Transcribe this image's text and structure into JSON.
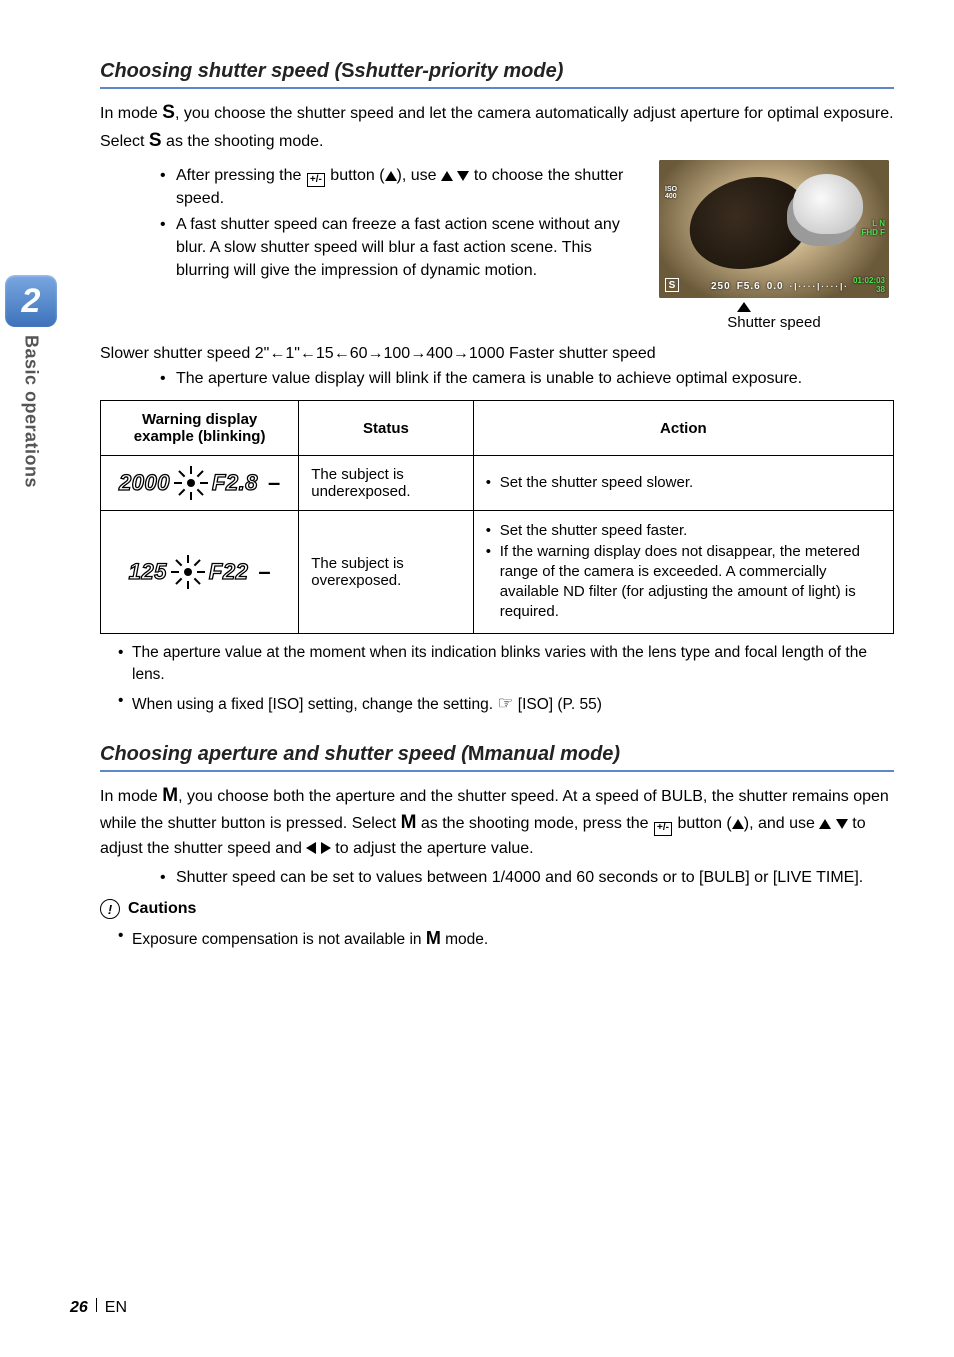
{
  "sidebar": {
    "chapter_number": "2",
    "chapter_title": "Basic operations"
  },
  "section1": {
    "title_pre": "Choosing shutter speed (",
    "title_mode": "S",
    "title_post": " shutter-priority mode)",
    "intro_a": "In mode ",
    "intro_b": ", you choose the shutter speed and let the camera automatically adjust aperture for optimal exposure. Select ",
    "intro_c": " as the shooting mode.",
    "mode": "S",
    "bullet1_a": "After pressing the ",
    "bullet1_icon": "+/-",
    "bullet1_b": " button (",
    "bullet1_c": "), use ",
    "bullet1_d": " to choose the shutter speed.",
    "bullet2": "A fast shutter speed can freeze a fast action scene without any blur. A slow shutter speed will blur a fast action scene. This blurring will give the impression of dynamic motion.",
    "lcd": {
      "iso_label": "ISO",
      "iso_value": "400",
      "format_line1": "L N",
      "format_line2": "FHD F",
      "time_line1": "01:02:03",
      "time_line2": "38",
      "mode_badge": "S",
      "shutter": "250",
      "aperture": "F5.6",
      "ev": "0.0",
      "caption": "Shutter speed"
    },
    "sequence_pre": "Slower shutter speed ",
    "sequence_values": [
      "2\"",
      "1\"",
      "15",
      "60",
      "100",
      "400",
      "1000"
    ],
    "sequence_post": " Faster shutter speed",
    "sequence_bullet": "The aperture value display will blink if the camera is unable to achieve optimal exposure.",
    "table": {
      "headers": [
        "Warning display example (blinking)",
        "Status",
        "Action"
      ],
      "rows": [
        {
          "example": {
            "shutter": "2000",
            "aperture": "F2.8"
          },
          "status": "The subject is underexposed.",
          "actions": [
            "Set the shutter speed slower."
          ]
        },
        {
          "example": {
            "shutter": "125",
            "aperture": "F22"
          },
          "status": "The subject is overexposed.",
          "actions": [
            "Set the shutter speed faster.",
            "If the warning display does not disappear, the metered range of the camera is exceeded. A commercially available ND filter (for adjusting the amount of light) is required."
          ]
        }
      ]
    },
    "notes": [
      "The aperture value at the moment when its indication blinks varies with the lens type and focal length of the lens.",
      "When using a fixed [ISO] setting, change the setting. "
    ],
    "note2_ref_icon": "☞",
    "note2_ref": " [ISO] (P. 55)"
  },
  "section2": {
    "title_pre": "Choosing aperture and shutter speed (",
    "title_mode": "M",
    "title_post": " manual mode)",
    "mode": "M",
    "intro_a": "In mode ",
    "intro_b": ", you choose both the aperture and the shutter speed. At a speed of BULB, the shutter remains open while the shutter button is pressed. Select ",
    "intro_c": " as the shooting mode, press the ",
    "intro_icon": "+/-",
    "intro_d": " button (",
    "intro_e": "), and use ",
    "intro_f": " to adjust the shutter speed and ",
    "intro_g": " to adjust the aperture value.",
    "bullet": "Shutter speed can be set to values between 1/4000 and 60 seconds or to [BULB] or [LIVE TIME].",
    "cautions_label": "Cautions",
    "caution_a": "Exposure compensation is not available in ",
    "caution_b": " mode."
  },
  "footer": {
    "page": "26",
    "lang": "EN"
  }
}
